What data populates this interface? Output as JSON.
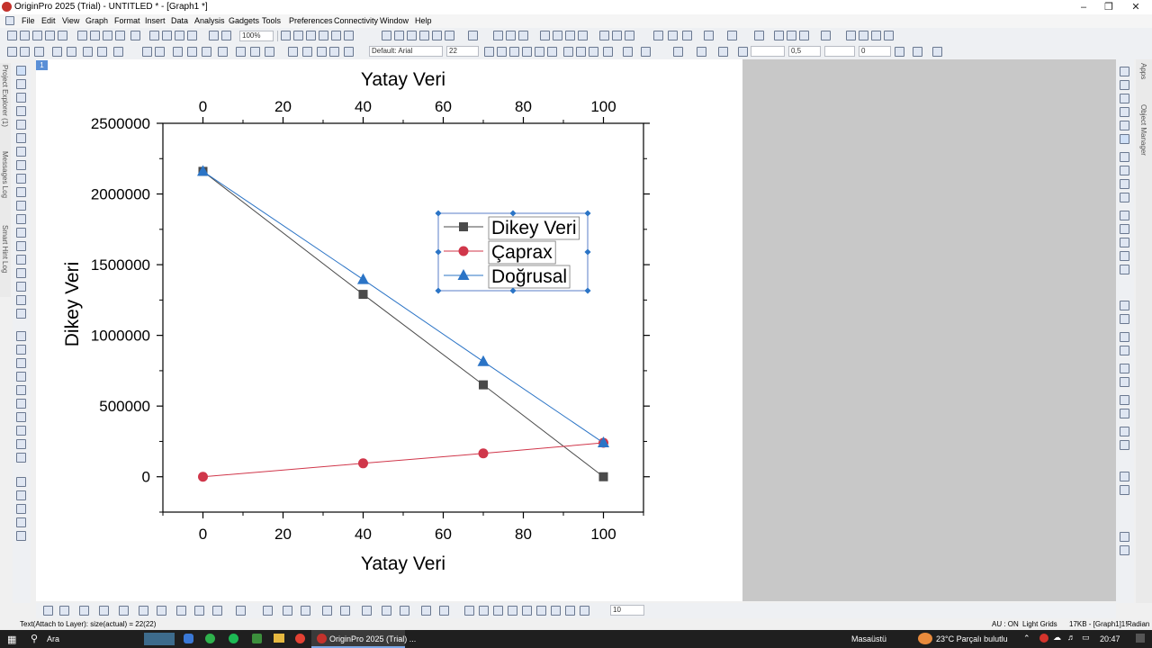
{
  "window": {
    "title": "OriginPro 2025 (Trial) - UNTITLED * - [Graph1 *]"
  },
  "menu": [
    "File",
    "Edit",
    "View",
    "Graph",
    "Format",
    "Insert",
    "Data",
    "Analysis",
    "Gadgets",
    "Tools",
    "Preferences",
    "Connectivity",
    "Window",
    "Help"
  ],
  "toolbar": {
    "zoom": "100%",
    "font": "Default: Arial",
    "font_size": "22",
    "line_width": "0,5",
    "value_zero": "0",
    "bottom_value": "10"
  },
  "side_tabs": [
    "Project Explorer (1)",
    "Messages Log",
    "Smart Hint Log"
  ],
  "right_tabs": [
    "Apps",
    "Object Manager"
  ],
  "layer_indicator": "1",
  "chart_data": {
    "type": "line",
    "title": "",
    "xlabel": "Yatay Veri",
    "ylabel": "Dikey Veri",
    "top_xlabel": "Yatay Veri",
    "xlim": [
      -10,
      110
    ],
    "ylim": [
      -250000,
      2500000
    ],
    "x_ticks": [
      "0",
      "20",
      "40",
      "60",
      "80",
      "100"
    ],
    "y_ticks": [
      "0",
      "500000",
      "1000000",
      "1500000",
      "2000000",
      "2500000"
    ],
    "x": [
      0,
      40,
      70,
      100
    ],
    "series": [
      {
        "name": "Dikey Veri",
        "marker": "square",
        "color": "#4a4a4a",
        "values": [
          2160000,
          1290000,
          650000,
          0
        ]
      },
      {
        "name": "Çaprax",
        "marker": "circle",
        "color": "#d0364a",
        "values": [
          0,
          95000,
          165000,
          240000
        ]
      },
      {
        "name": "Doğrusal",
        "marker": "triangle",
        "color": "#2b74c6",
        "values": [
          2160000,
          1395000,
          815000,
          240000
        ]
      }
    ],
    "legend_position": "top-right",
    "grid": false
  },
  "status": {
    "left": "Text(Attach to Layer): size(actual) = 22(22)",
    "au": "AU : ON",
    "grids": "Light Grids",
    "info": "17KB - [Graph1]1!",
    "units": "Radian"
  },
  "taskbar": {
    "search": "Ara",
    "app": "OriginPro 2025 (Trial) ...",
    "desktop": "Masaüstü",
    "weather": "23°C  Parçalı bulutlu",
    "time": "20:47"
  }
}
